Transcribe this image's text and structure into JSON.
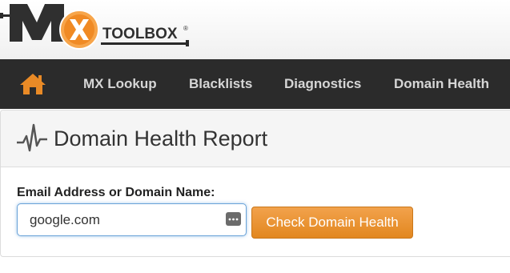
{
  "logo": {
    "brand_letters": "MX",
    "brand_name": "TOOLBOX",
    "trademark": "®"
  },
  "nav": {
    "home_icon": "home-icon",
    "items": [
      {
        "label": "MX Lookup"
      },
      {
        "label": "Blacklists"
      },
      {
        "label": "Diagnostics"
      },
      {
        "label": "Domain Health"
      }
    ]
  },
  "panel": {
    "icon": "pulse-icon",
    "title": "Domain Health Report",
    "field_label": "Email Address or Domain Name:",
    "input_value": "google.com",
    "password_icon": "password-manager-icon",
    "button_label": "Check Domain Health"
  },
  "colors": {
    "nav_bg": "#2b2b2b",
    "accent_orange": "#e8891f",
    "input_focus": "#6aa3d8"
  }
}
